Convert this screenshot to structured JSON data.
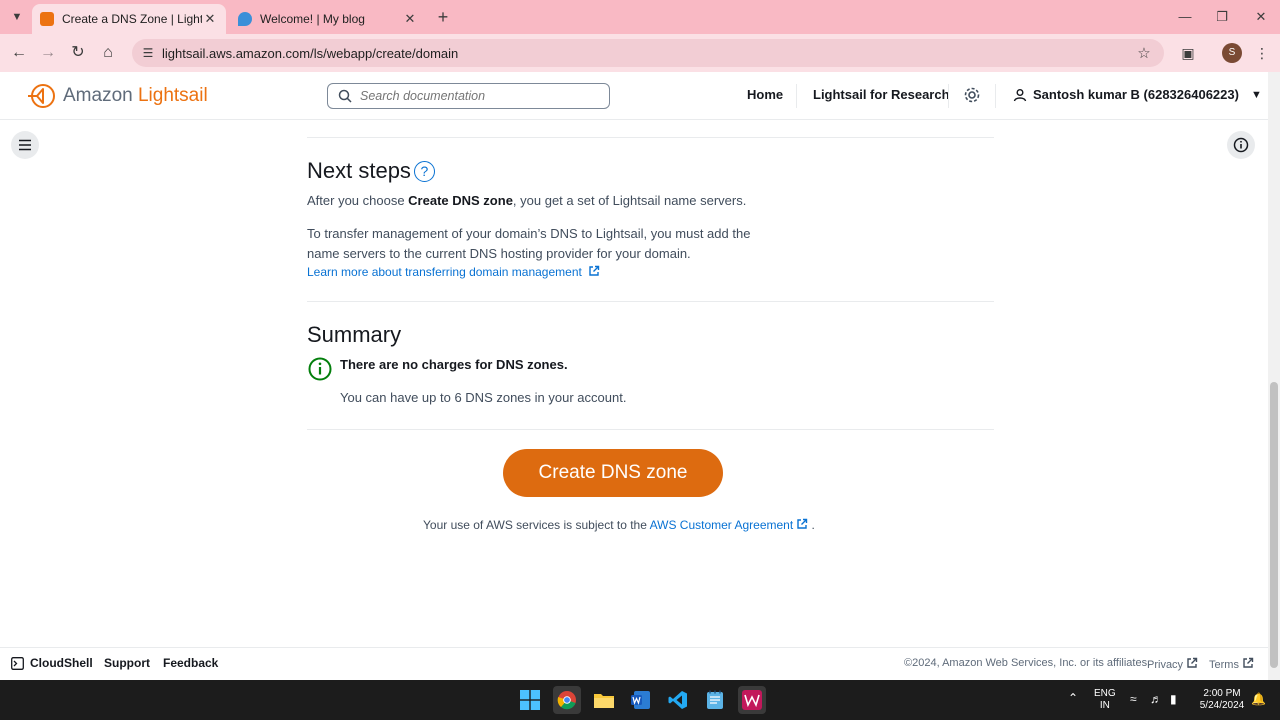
{
  "browser": {
    "tabs": [
      {
        "title": "Create a DNS Zone | Lightsail",
        "favicon_color": "#ec7211",
        "active": true
      },
      {
        "title": "Welcome! | My blog",
        "favicon_color": "#3b8fd8",
        "active": false
      }
    ],
    "url": "lightsail.aws.amazon.com/ls/webapp/create/domain",
    "new_tab": "+",
    "profile_initial": "S"
  },
  "header": {
    "logo_prefix": "Amazon ",
    "logo_brand": "Lightsail",
    "search_placeholder": "Search documentation",
    "nav_home": "Home",
    "nav_research": "Lightsail for Research",
    "user_label": "Santosh kumar B (628326406223)"
  },
  "next_steps": {
    "heading": "Next steps",
    "line1_prefix": "After you choose ",
    "line1_bold": "Create DNS zone",
    "line1_suffix": ", you get a set of Lightsail name servers.",
    "line2": "To transfer management of your domain’s DNS to Lightsail, you must add the",
    "line3": "name servers to the current DNS hosting provider for your domain.",
    "link": "Learn more about transferring domain management"
  },
  "summary": {
    "heading": "Summary",
    "bold": "There are no charges for DNS zones.",
    "sub": "You can have up to 6 DNS zones in your account."
  },
  "cta_label": "Create DNS zone",
  "agreement": {
    "prefix": "Your use of AWS services is subject to the ",
    "link": "AWS Customer Agreement",
    "suffix": "."
  },
  "footer": {
    "cloudshell": "CloudShell",
    "support": "Support",
    "feedback": "Feedback",
    "copyright": "©2024, Amazon Web Services, Inc. or its affiliates.",
    "privacy": "Privacy",
    "terms": "Terms"
  },
  "taskbar": {
    "lang_top": "ENG",
    "lang_bottom": "IN",
    "time": "2:00 PM",
    "date": "5/24/2024"
  },
  "colors": {
    "accent": "#ec7211",
    "cta": "#dd6b10",
    "link": "#0972d3",
    "success": "#037f0c",
    "browser_frame": "#f9b9c4"
  }
}
